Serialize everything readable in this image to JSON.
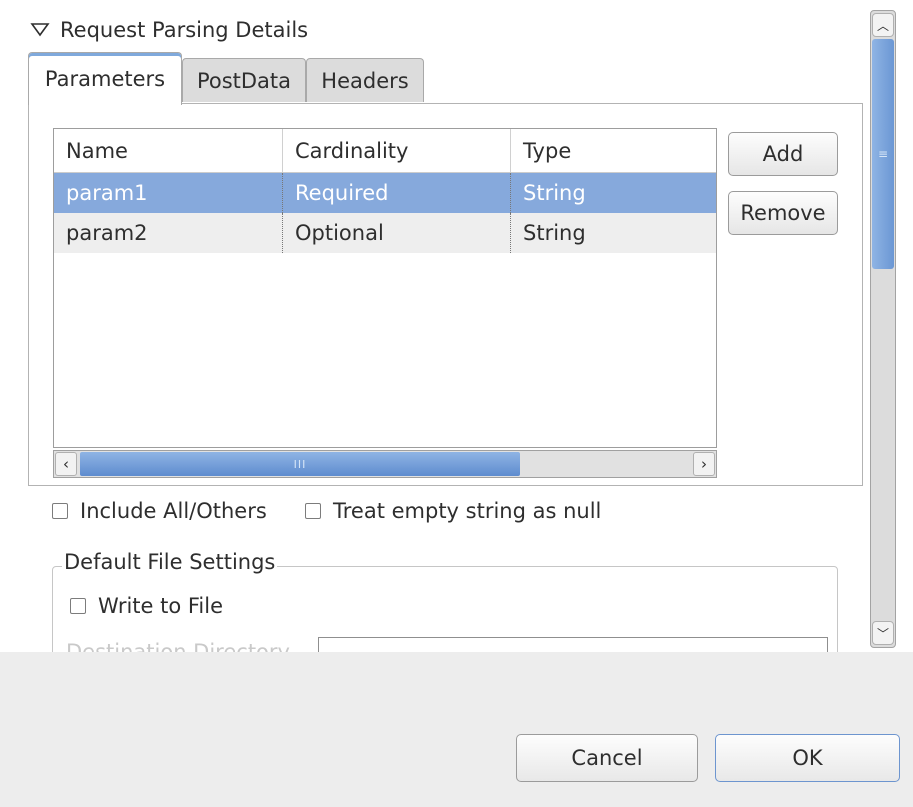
{
  "section": {
    "title": "Request Parsing Details",
    "icon": "triangle-down-icon"
  },
  "tabs": [
    {
      "label": "Parameters",
      "active": true
    },
    {
      "label": "PostData",
      "active": false
    },
    {
      "label": "Headers",
      "active": false
    }
  ],
  "table": {
    "columns": [
      "Name",
      "Cardinality",
      "Type"
    ],
    "rows": [
      {
        "name": "param1",
        "cardinality": "Required",
        "type": "String",
        "selected": true
      },
      {
        "name": "param2",
        "cardinality": "Optional",
        "type": "String",
        "selected": false
      }
    ],
    "scroll_grip": "III"
  },
  "buttons": {
    "add": "Add",
    "remove": "Remove",
    "cancel": "Cancel",
    "ok": "OK"
  },
  "options": {
    "include_all": {
      "label": "Include All/Others",
      "checked": false
    },
    "treat_empty_null": {
      "label": "Treat empty string as null",
      "checked": false
    }
  },
  "file_settings": {
    "legend": "Default File Settings",
    "write_to_file": {
      "label": "Write to File",
      "checked": false
    },
    "destination_label": "Destination Directory"
  },
  "colors": {
    "selection": "#86a9dc",
    "accent": "#6b97d4"
  }
}
